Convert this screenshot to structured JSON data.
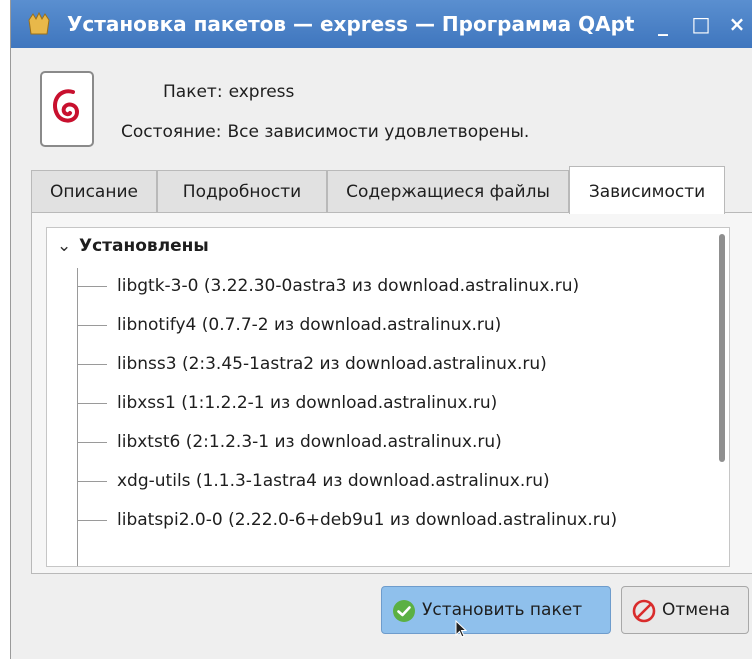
{
  "window": {
    "title": "Установка пакетов — express — Программа QApt для...",
    "minimize_glyph": "_",
    "maximize_glyph": "□",
    "close_glyph": "×"
  },
  "package": {
    "label": "Пакет:",
    "name": "express",
    "state_label": "Состояние:",
    "state_value": "Все зависимости удовлетворены."
  },
  "tabs": [
    {
      "label": "Описание"
    },
    {
      "label": "Подробности"
    },
    {
      "label": "Содержащиеся файлы"
    },
    {
      "label": "Зависимости",
      "active": true
    }
  ],
  "tree": {
    "group_label": "Установлены",
    "items": [
      "libgtk-3-0 (3.22.30-0astra3 из download.astralinux.ru)",
      "libnotify4 (0.7.7-2 из download.astralinux.ru)",
      "libnss3 (2:3.45-1astra2 из download.astralinux.ru)",
      "libxss1 (1:1.2.2-1 из download.astralinux.ru)",
      "libxtst6 (2:1.2.3-1 из download.astralinux.ru)",
      "xdg-utils (1.1.3-1astra4 из download.astralinux.ru)",
      "libatspi2.0-0 (2.22.0-6+deb9u1 из download.astralinux.ru)"
    ]
  },
  "buttons": {
    "install_label": "Установить пакет",
    "cancel_label": "Отмена"
  },
  "colors": {
    "titlebar": "#3f76be",
    "install_button": "#8fc0ec",
    "debian_swirl": "#c8102e"
  },
  "icons": {
    "app": "qapt-icon",
    "package": "debian-package-icon",
    "install": "check-circle-icon",
    "cancel": "no-entry-icon"
  }
}
